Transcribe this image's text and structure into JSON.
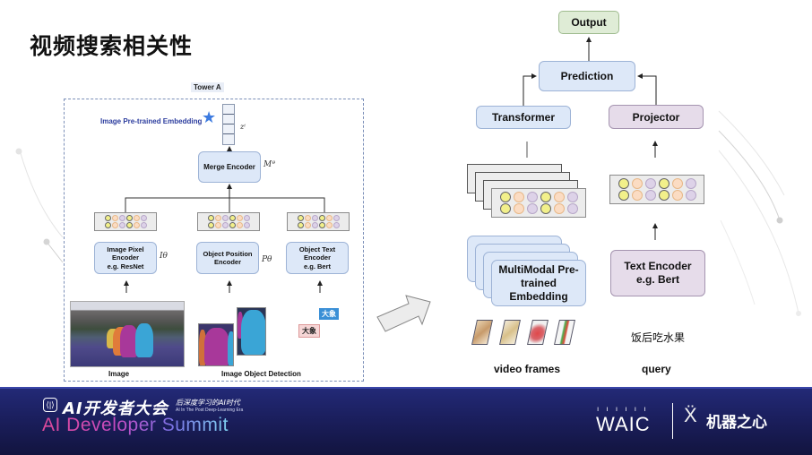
{
  "slide": {
    "title": "视频搜索相关性"
  },
  "tower_a": {
    "label": "Tower A",
    "embedding_label": "Image Pre-trained Embedding",
    "embedding_symbol": "zⁱ",
    "merge_encoder": "Merge Encoder",
    "merge_symbol": "Mᶿ",
    "encoders": [
      {
        "lines": [
          "Image Pixel",
          "Encoder",
          "e.g. ResNet"
        ],
        "symbol": "Iθ"
      },
      {
        "lines": [
          "Object Position",
          "Encoder"
        ],
        "symbol": "Pθ"
      },
      {
        "lines": [
          "Object Text",
          "Encoder",
          "e.g. Bert"
        ],
        "symbol": ""
      }
    ],
    "dot_pattern": [
      "y",
      "o",
      "p",
      "y",
      "o",
      "p"
    ],
    "image_label": "Image",
    "detection_label": "Image Object Detection",
    "tags": [
      "大象",
      "大象"
    ]
  },
  "right_diagram": {
    "output": "Output",
    "prediction": "Prediction",
    "transformer": "Transformer",
    "projector": "Projector",
    "multimodal": "MultiModal Pre-trained Embedding",
    "text_encoder_lines": [
      "Text Encoder",
      "e.g. Bert"
    ],
    "video_frames_label": "video frames",
    "query_label": "query",
    "query_text": "饭后吃水果",
    "dot_pattern": [
      "y",
      "o",
      "p",
      "y",
      "o",
      "p"
    ]
  },
  "footer": {
    "event_cn": "AI开发者大会",
    "event_tagline_cn": "后深度学习的AI时代",
    "event_tagline_en": "AI In The Post Deep-Learning Era",
    "event_en": "AI Developer Summit",
    "sponsor1": "WAIC",
    "sponsor2": "机器之心",
    "colors": {
      "footer_bg": "#1b1f5e",
      "gradient_start": "#e04a9a",
      "gradient_end": "#7fd2f0"
    }
  },
  "colors": {
    "blue_box": "#dde8f8",
    "purple_box": "#e6dcea",
    "green_box": "#dfecd6",
    "dot_yellow": "#f2f08a",
    "dot_orange": "#fbdcc3",
    "dot_purple": "#ddd2e8"
  }
}
